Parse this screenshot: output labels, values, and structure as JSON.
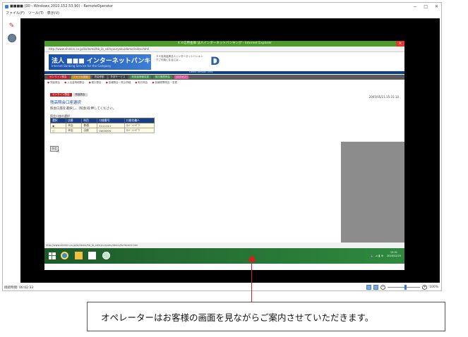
{
  "operator_window": {
    "title": "■■■■ (30 - Windows 2010.152.53.90) - RemoteOperator",
    "menu": [
      "ファイル(F)",
      "ツール(T)",
      "表示(V)"
    ],
    "window_controls": [
      "−",
      "□",
      "✕"
    ],
    "status_left": "接続時間: 00:02:33",
    "zoom_label": "100%",
    "zoom_minus": "−",
    "zoom_plus": "+"
  },
  "remote_screen": {
    "ie_title": "ＸＸ信用金庫 法人インターネットバンキング - Internet Explorer",
    "ie_close": "✕",
    "address": "http://www.shinkin.co.jp/ib/demo/hb_ib_sd/nyuuryoku/demo/index.html",
    "bank_logo_text": "法人 ■■■ インターネットバンキングサービス",
    "bank_logo_sub": "Internet Banking Service for the Company",
    "bank_notice": "ＸＸ信用金庫法人インターネットバンキングご利用になるには…",
    "bank_mark": "D",
    "strip_text": "Demo Version Only",
    "nav_main": [
      {
        "label": "オンライン照会",
        "color": "red"
      },
      {
        "label": "ファイル送信",
        "color": "orange"
      },
      {
        "label": "資金移動",
        "color": "gray"
      },
      {
        "label": "外部サービス",
        "color": "gray"
      },
      {
        "label": "利用者情報変更",
        "color": "green"
      },
      {
        "label": "取引履歴照会",
        "color": "green"
      },
      {
        "label": "ログオフ",
        "color": "pink"
      }
    ],
    "nav_sub": [
      "残高照会",
      "入出金明細照会",
      "取引照会",
      "各種照会・振込明細",
      "取引照会",
      "各種帳票照会・変更"
    ],
    "crumb": [
      "オンライン照会",
      "残高照会"
    ],
    "date_time": "2005/05/11 15:31:10",
    "page_heading": "残高照会口座選択",
    "instruction": "照会口座を選択し、[照会]を押してください。",
    "table_caption": "照会口座の選択",
    "table_headers": [
      "選択",
      "店番",
      "科目",
      "口座番号",
      "口座名義人"
    ],
    "table_rows": [
      [
        "◉",
        "本店",
        "普通",
        "1111111",
        "ﾛﾝｼﾞﾝｼｬｸﾞｳ"
      ],
      [
        "○",
        "本店",
        "当座",
        "0000000",
        "ﾛﾝｼﾞﾝｼｬｸﾞｳ"
      ]
    ],
    "next_button": "照会",
    "ie_status": "http://www.shinkin.co.jp/ib/demo/hb_ib_sd/nyuuryoku/demo/furikomi2.htm",
    "tray": "🔈 ⊿ ▮ ⊕",
    "clock_time": "15:31",
    "clock_date": "2016/12/20"
  },
  "annotation": {
    "note": "オペレーターはお客様の画面を見ながらご案内させていただきます。",
    "arrow_color": "#d42020"
  }
}
